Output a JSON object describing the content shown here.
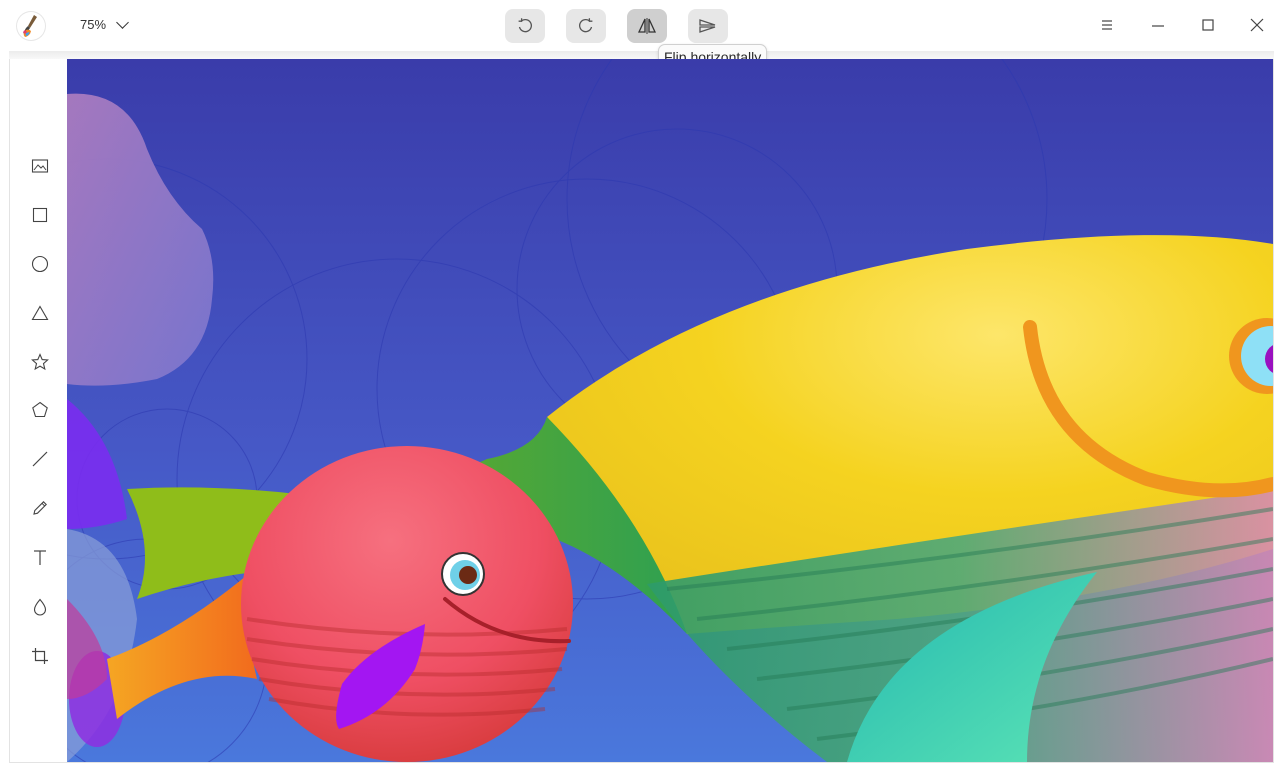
{
  "titlebar": {
    "zoom_value": "75%",
    "buttons": [
      {
        "id": "rotate-left",
        "icon": "rotate-left-icon"
      },
      {
        "id": "rotate-right",
        "icon": "rotate-right-icon"
      },
      {
        "id": "flip-horizontal",
        "icon": "flip-horizontal-icon",
        "active": true
      },
      {
        "id": "flip-vertical",
        "icon": "flip-vertical-icon"
      }
    ],
    "tooltip": "Flip horizontally",
    "window_controls": [
      "menu-icon",
      "minimize-icon",
      "maximize-icon",
      "close-icon"
    ]
  },
  "tools": [
    {
      "name": "import-image-tool",
      "icon": "image-icon"
    },
    {
      "name": "rectangle-tool",
      "icon": "rectangle-icon"
    },
    {
      "name": "ellipse-tool",
      "icon": "ellipse-icon"
    },
    {
      "name": "triangle-tool",
      "icon": "triangle-icon"
    },
    {
      "name": "star-tool",
      "icon": "star-icon"
    },
    {
      "name": "polygon-tool",
      "icon": "pentagon-icon"
    },
    {
      "name": "line-tool",
      "icon": "line-icon"
    },
    {
      "name": "pencil-tool",
      "icon": "pencil-icon"
    },
    {
      "name": "text-tool",
      "icon": "text-icon"
    },
    {
      "name": "blur-tool",
      "icon": "drop-icon"
    },
    {
      "name": "crop-tool",
      "icon": "crop-icon"
    }
  ],
  "colors": {
    "canvas_top": "#3a3caa",
    "canvas_bottom": "#4a78dc",
    "big_fish": "#f5d320",
    "small_fish": "#f0546e",
    "fin_purple": "#9b19f0",
    "fin_teal": "#39d4b0"
  }
}
